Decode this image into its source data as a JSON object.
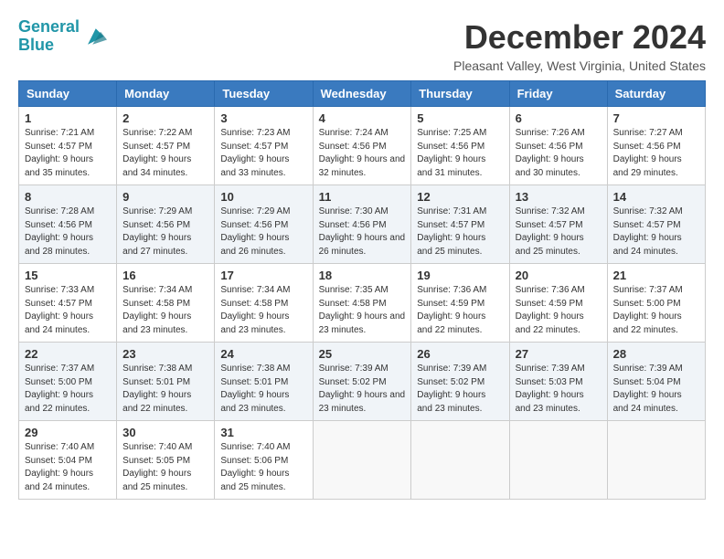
{
  "logo": {
    "line1": "General",
    "line2": "Blue"
  },
  "title": "December 2024",
  "location": "Pleasant Valley, West Virginia, United States",
  "days_header": [
    "Sunday",
    "Monday",
    "Tuesday",
    "Wednesday",
    "Thursday",
    "Friday",
    "Saturday"
  ],
  "weeks": [
    [
      {
        "day": "1",
        "sunrise": "7:21 AM",
        "sunset": "4:57 PM",
        "daylight": "9 hours and 35 minutes."
      },
      {
        "day": "2",
        "sunrise": "7:22 AM",
        "sunset": "4:57 PM",
        "daylight": "9 hours and 34 minutes."
      },
      {
        "day": "3",
        "sunrise": "7:23 AM",
        "sunset": "4:57 PM",
        "daylight": "9 hours and 33 minutes."
      },
      {
        "day": "4",
        "sunrise": "7:24 AM",
        "sunset": "4:56 PM",
        "daylight": "9 hours and 32 minutes."
      },
      {
        "day": "5",
        "sunrise": "7:25 AM",
        "sunset": "4:56 PM",
        "daylight": "9 hours and 31 minutes."
      },
      {
        "day": "6",
        "sunrise": "7:26 AM",
        "sunset": "4:56 PM",
        "daylight": "9 hours and 30 minutes."
      },
      {
        "day": "7",
        "sunrise": "7:27 AM",
        "sunset": "4:56 PM",
        "daylight": "9 hours and 29 minutes."
      }
    ],
    [
      {
        "day": "8",
        "sunrise": "7:28 AM",
        "sunset": "4:56 PM",
        "daylight": "9 hours and 28 minutes."
      },
      {
        "day": "9",
        "sunrise": "7:29 AM",
        "sunset": "4:56 PM",
        "daylight": "9 hours and 27 minutes."
      },
      {
        "day": "10",
        "sunrise": "7:29 AM",
        "sunset": "4:56 PM",
        "daylight": "9 hours and 26 minutes."
      },
      {
        "day": "11",
        "sunrise": "7:30 AM",
        "sunset": "4:56 PM",
        "daylight": "9 hours and 26 minutes."
      },
      {
        "day": "12",
        "sunrise": "7:31 AM",
        "sunset": "4:57 PM",
        "daylight": "9 hours and 25 minutes."
      },
      {
        "day": "13",
        "sunrise": "7:32 AM",
        "sunset": "4:57 PM",
        "daylight": "9 hours and 25 minutes."
      },
      {
        "day": "14",
        "sunrise": "7:32 AM",
        "sunset": "4:57 PM",
        "daylight": "9 hours and 24 minutes."
      }
    ],
    [
      {
        "day": "15",
        "sunrise": "7:33 AM",
        "sunset": "4:57 PM",
        "daylight": "9 hours and 24 minutes."
      },
      {
        "day": "16",
        "sunrise": "7:34 AM",
        "sunset": "4:58 PM",
        "daylight": "9 hours and 23 minutes."
      },
      {
        "day": "17",
        "sunrise": "7:34 AM",
        "sunset": "4:58 PM",
        "daylight": "9 hours and 23 minutes."
      },
      {
        "day": "18",
        "sunrise": "7:35 AM",
        "sunset": "4:58 PM",
        "daylight": "9 hours and 23 minutes."
      },
      {
        "day": "19",
        "sunrise": "7:36 AM",
        "sunset": "4:59 PM",
        "daylight": "9 hours and 22 minutes."
      },
      {
        "day": "20",
        "sunrise": "7:36 AM",
        "sunset": "4:59 PM",
        "daylight": "9 hours and 22 minutes."
      },
      {
        "day": "21",
        "sunrise": "7:37 AM",
        "sunset": "5:00 PM",
        "daylight": "9 hours and 22 minutes."
      }
    ],
    [
      {
        "day": "22",
        "sunrise": "7:37 AM",
        "sunset": "5:00 PM",
        "daylight": "9 hours and 22 minutes."
      },
      {
        "day": "23",
        "sunrise": "7:38 AM",
        "sunset": "5:01 PM",
        "daylight": "9 hours and 22 minutes."
      },
      {
        "day": "24",
        "sunrise": "7:38 AM",
        "sunset": "5:01 PM",
        "daylight": "9 hours and 23 minutes."
      },
      {
        "day": "25",
        "sunrise": "7:39 AM",
        "sunset": "5:02 PM",
        "daylight": "9 hours and 23 minutes."
      },
      {
        "day": "26",
        "sunrise": "7:39 AM",
        "sunset": "5:02 PM",
        "daylight": "9 hours and 23 minutes."
      },
      {
        "day": "27",
        "sunrise": "7:39 AM",
        "sunset": "5:03 PM",
        "daylight": "9 hours and 23 minutes."
      },
      {
        "day": "28",
        "sunrise": "7:39 AM",
        "sunset": "5:04 PM",
        "daylight": "9 hours and 24 minutes."
      }
    ],
    [
      {
        "day": "29",
        "sunrise": "7:40 AM",
        "sunset": "5:04 PM",
        "daylight": "9 hours and 24 minutes."
      },
      {
        "day": "30",
        "sunrise": "7:40 AM",
        "sunset": "5:05 PM",
        "daylight": "9 hours and 25 minutes."
      },
      {
        "day": "31",
        "sunrise": "7:40 AM",
        "sunset": "5:06 PM",
        "daylight": "9 hours and 25 minutes."
      },
      null,
      null,
      null,
      null
    ]
  ],
  "labels": {
    "sunrise": "Sunrise:",
    "sunset": "Sunset:",
    "daylight": "Daylight:"
  }
}
